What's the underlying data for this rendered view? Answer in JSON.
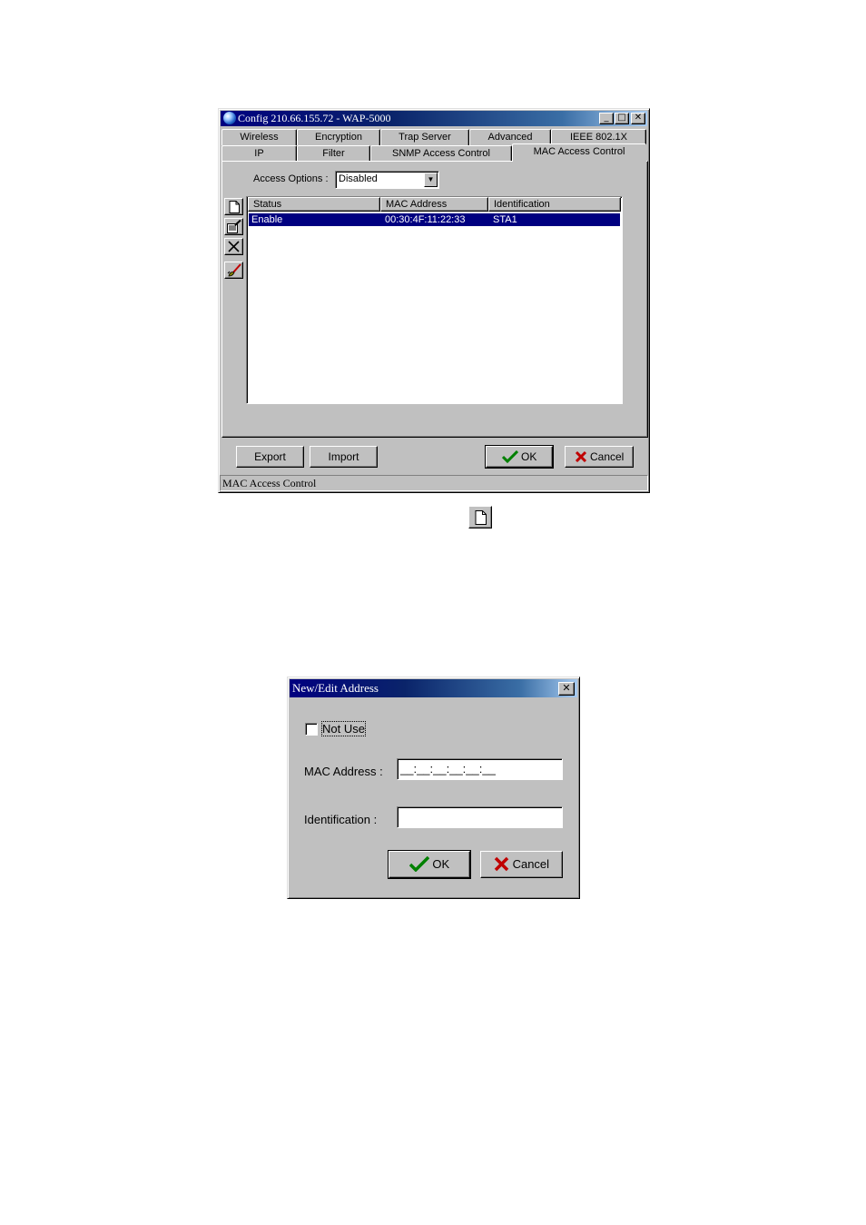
{
  "config_window": {
    "title": "Config 210.66.155.72 - WAP-5000",
    "controls": {
      "minimize": "_",
      "maximize": "□",
      "close": "✕"
    },
    "tabs_row1": [
      "Wireless",
      "Encryption",
      "Trap Server",
      "Advanced",
      "IEEE 802.1X"
    ],
    "tabs_row2": [
      "IP",
      "Filter",
      "SNMP Access Control",
      "MAC Access Control"
    ],
    "active_tab": "MAC Access Control",
    "access_options_label": "Access Options :",
    "access_options_value": "Disabled",
    "table": {
      "columns": [
        "Status",
        "MAC Address",
        "Identification"
      ],
      "rows": [
        {
          "status": "Enable",
          "mac": "00:30:4F:11:22:33",
          "identification": "STA1"
        }
      ]
    },
    "buttons": {
      "export": "Export",
      "import": "Import",
      "ok": "OK",
      "cancel": "Cancel"
    },
    "status_bar": "MAC Access Control",
    "icons": [
      "new-icon",
      "edit-icon",
      "delete-icon",
      "clear-icon"
    ]
  },
  "dialog": {
    "title": "New/Edit Address",
    "close": "✕",
    "not_use_label": "Not Use",
    "not_use_checked": false,
    "mac_label": "MAC Address :",
    "mac_value": "__:__:__:__:__:__",
    "identification_label": "Identification :",
    "identification_value": "",
    "ok": "OK",
    "cancel": "Cancel"
  }
}
